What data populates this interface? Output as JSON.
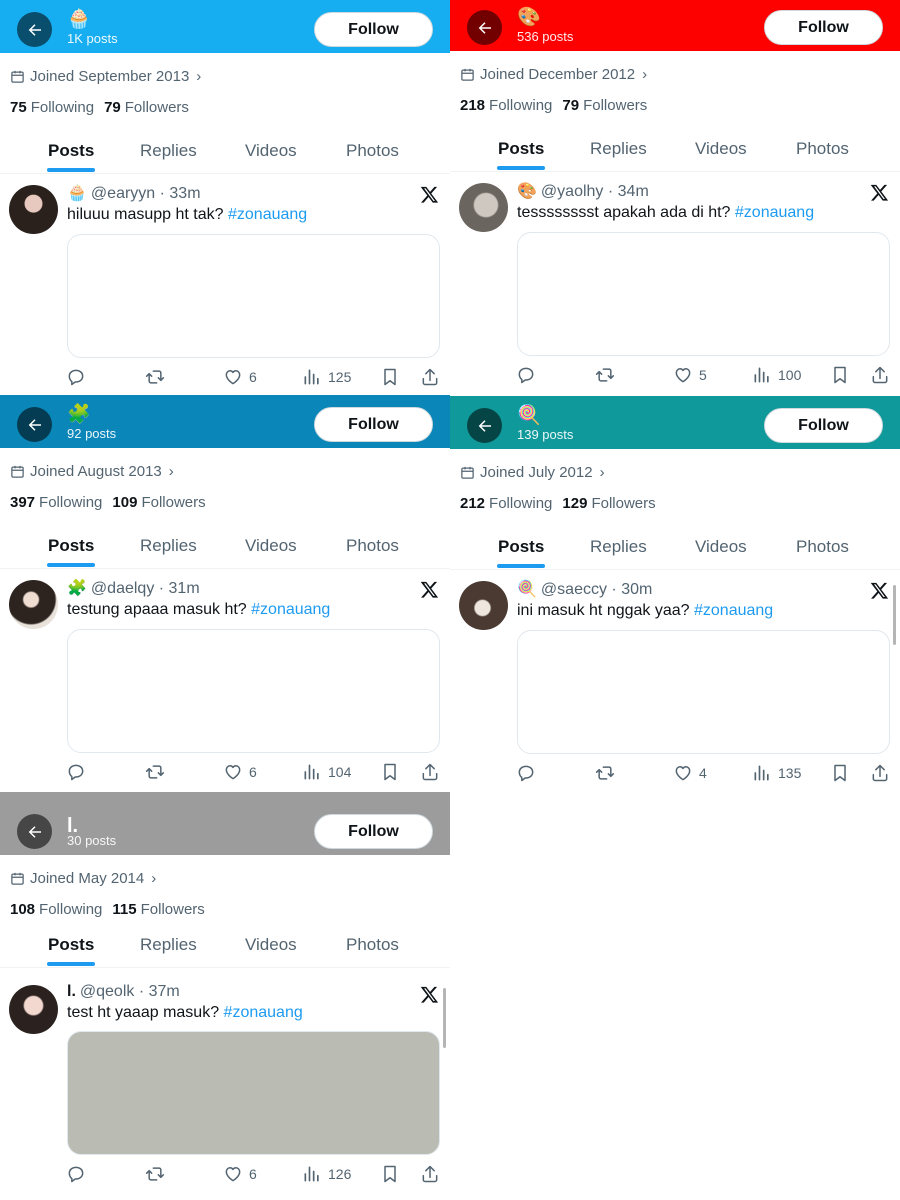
{
  "profiles": [
    {
      "header_color": "#16aef1",
      "header_name": "🧁",
      "posts_count": "1K posts",
      "follow_label": "Follow",
      "joined": "Joined September 2013",
      "following_count": "75",
      "following_label": "Following",
      "followers_count": "79",
      "followers_label": "Followers",
      "tabs": [
        "Posts",
        "Replies",
        "Videos",
        "Photos"
      ],
      "tweet": {
        "display_name": "🧁",
        "handle": "@earyyn",
        "time": "33m",
        "text": "hiluuu masupp ht tak?",
        "hashtag": "#zonauang",
        "media_color": "#ffffff",
        "likes": "6",
        "views": "125"
      }
    },
    {
      "header_color": "#fd0101",
      "header_name": "🎨",
      "posts_count": "536 posts",
      "follow_label": "Follow",
      "joined": "Joined December 2012",
      "following_count": "218",
      "following_label": "Following",
      "followers_count": "79",
      "followers_label": "Followers",
      "tabs": [
        "Posts",
        "Replies",
        "Videos",
        "Photos"
      ],
      "tweet": {
        "display_name": "🎨",
        "handle": "@yaolhy",
        "time": "34m",
        "text": "tesssssssst apakah ada di ht?",
        "hashtag": "#zonauang",
        "media_color": "#ffffff",
        "likes": "5",
        "views": "100"
      }
    },
    {
      "header_color": "#0a86b9",
      "header_name": "🧩",
      "posts_count": "92 posts",
      "follow_label": "Follow",
      "joined": "Joined August 2013",
      "following_count": "397",
      "following_label": "Following",
      "followers_count": "109",
      "followers_label": "Followers",
      "tabs": [
        "Posts",
        "Replies",
        "Videos",
        "Photos"
      ],
      "tweet": {
        "display_name": "🧩",
        "handle": "@daelqy",
        "time": "31m",
        "text": "testung apaaa masuk ht?",
        "hashtag": "#zonauang",
        "media_color": "#ffffff",
        "likes": "6",
        "views": "104"
      }
    },
    {
      "header_color": "#0f999b",
      "header_name": "🍭",
      "posts_count": "139 posts",
      "follow_label": "Follow",
      "joined": "Joined July 2012",
      "following_count": "212",
      "following_label": "Following",
      "followers_count": "129",
      "followers_label": "Followers",
      "tabs": [
        "Posts",
        "Replies",
        "Videos",
        "Photos"
      ],
      "tweet": {
        "display_name": "🍭",
        "handle": "@saeccy",
        "time": "30m",
        "text": "ini masuk ht nggak yaa?",
        "hashtag": "#zonauang",
        "media_color": "#ffffff",
        "likes": "4",
        "views": "135"
      }
    },
    {
      "header_color": "#9c9c9c",
      "header_name": "l.",
      "posts_count": "30 posts",
      "follow_label": "Follow",
      "joined": "Joined May 2014",
      "following_count": "108",
      "following_label": "Following",
      "followers_count": "115",
      "followers_label": "Followers",
      "tabs": [
        "Posts",
        "Replies",
        "Videos",
        "Photos"
      ],
      "tweet": {
        "display_name": "l.",
        "handle": "@qeolk",
        "time": "37m",
        "text": "test ht yaaap masuk?",
        "hashtag": "#zonauang",
        "media_color": "#babcb4",
        "likes": "6",
        "views": "126"
      }
    }
  ],
  "icons": {
    "back": "arrow-left-icon",
    "joined": "calendar-icon",
    "brand": "x-logo-icon",
    "reply": "reply-icon",
    "retweet": "retweet-icon",
    "like": "heart-icon",
    "views": "views-icon",
    "bookmark": "bookmark-icon",
    "share": "share-icon"
  }
}
